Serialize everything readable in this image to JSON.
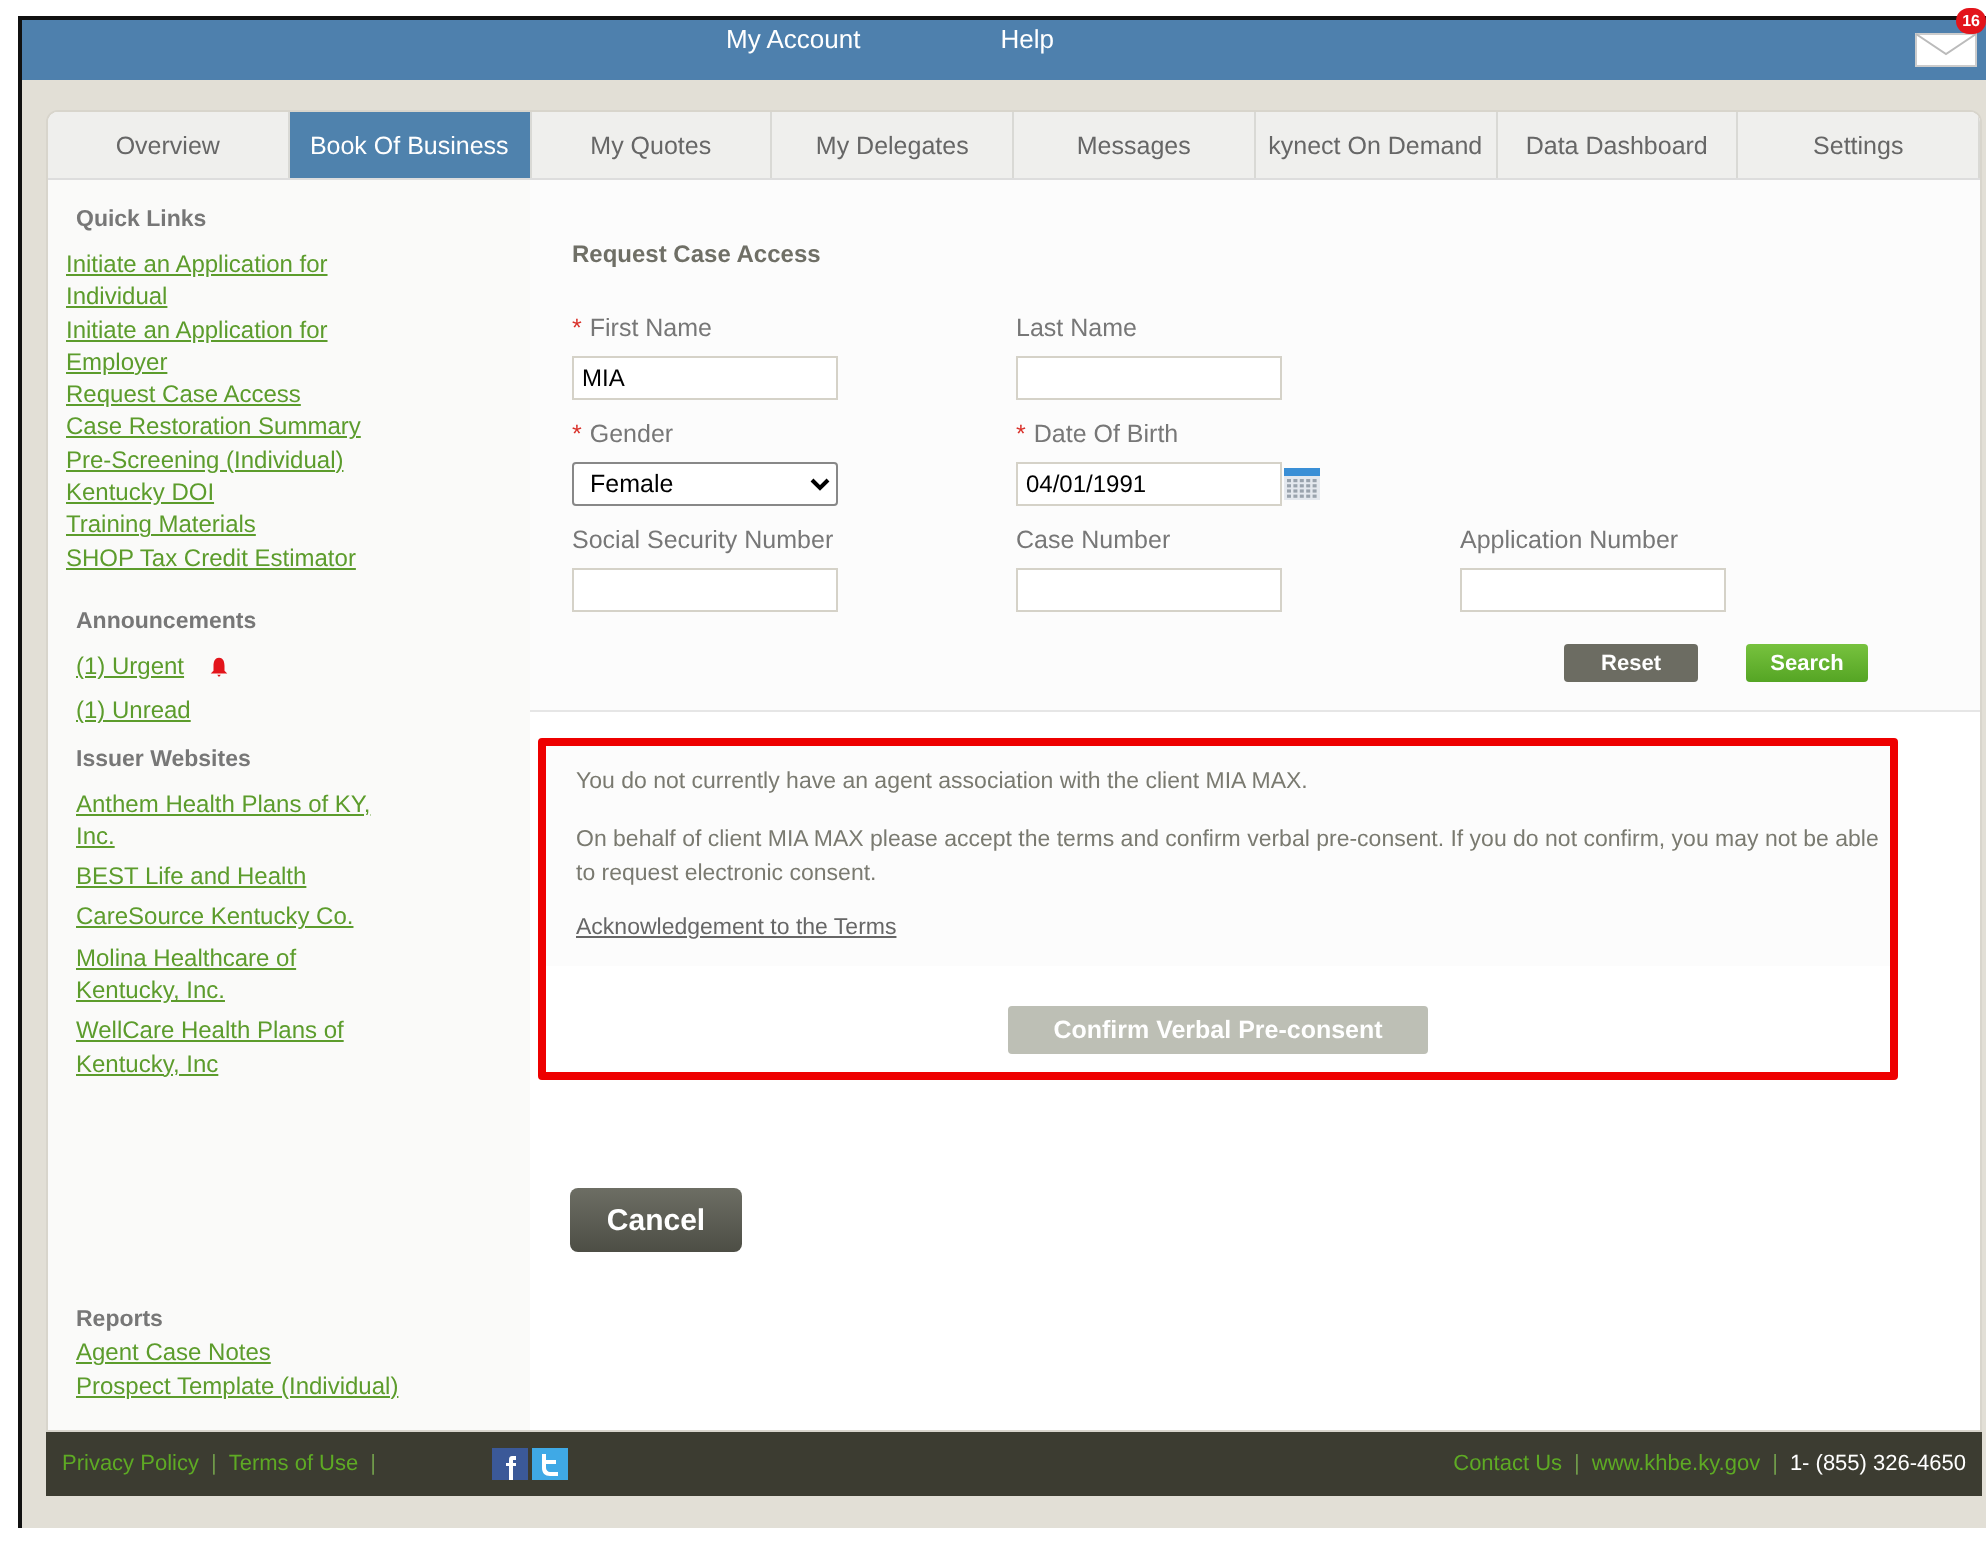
{
  "header": {
    "nav": [
      "My Account",
      "Help"
    ],
    "mail_count": "16"
  },
  "tabs": [
    {
      "label": "Overview",
      "selected": false
    },
    {
      "label": "Book Of Business",
      "selected": true
    },
    {
      "label": "My Quotes",
      "selected": false
    },
    {
      "label": "My Delegates",
      "selected": false
    },
    {
      "label": "Messages",
      "selected": false
    },
    {
      "label": "kynect On Demand",
      "selected": false
    },
    {
      "label": "Data Dashboard",
      "selected": false
    },
    {
      "label": "Settings",
      "selected": false
    }
  ],
  "sidebar": {
    "quick_links": {
      "title": "Quick Links",
      "links": [
        "Initiate an Application for Individual",
        "Initiate an Application for Employer",
        "Request Case Access",
        "Case Restoration Summary",
        "Pre-Screening (Individual)",
        "Kentucky DOI",
        "Training Materials",
        "SHOP Tax Credit Estimator"
      ]
    },
    "announcements": {
      "title": "Announcements",
      "links": [
        {
          "text": "(1) Urgent",
          "alert": true
        },
        {
          "text": "(1) Unread",
          "alert": false
        }
      ]
    },
    "issuer_websites": {
      "title": "Issuer Websites",
      "links": [
        "Anthem Health Plans of KY, Inc.",
        "BEST Life and Health",
        "CareSource Kentucky Co.",
        "Molina Healthcare of Kentucky, Inc.",
        "WellCare Health Plans of Kentucky, Inc"
      ]
    },
    "reports": {
      "title": "Reports",
      "links": [
        "Agent Case Notes",
        "Prospect Template (Individual)"
      ]
    }
  },
  "form": {
    "title": "Request Case Access",
    "required_mark": "*",
    "fields": [
      {
        "label": "First Name",
        "required": true,
        "kind": "text",
        "value": "MIA"
      },
      {
        "label": "Last Name",
        "required": false,
        "kind": "text"
      },
      {
        "kind": "empty"
      },
      {
        "label": "Gender",
        "required": true,
        "kind": "select",
        "value": "Female"
      },
      {
        "label": "Date Of Birth",
        "required": true,
        "kind": "date",
        "value": "04/01/1991"
      },
      {
        "kind": "empty"
      },
      {
        "label": "Social Security Number",
        "required": false,
        "kind": "text"
      },
      {
        "label": "Case Number",
        "required": false,
        "kind": "text"
      },
      {
        "label": "Application Number",
        "required": false,
        "kind": "text"
      }
    ],
    "buttons": [
      {
        "label": "Reset",
        "kind": "secondary"
      },
      {
        "label": "Search",
        "kind": "primary"
      }
    ]
  },
  "consent": {
    "messages": [
      "You do not currently have an agent association with the client MIA MAX.",
      "On behalf of client MIA MAX please accept the terms and confirm verbal pre-consent. If you do not confirm, you may not be able to request electronic consent."
    ],
    "link": "Acknowledgement to the Terms",
    "button": {
      "label": "Confirm Verbal Pre-consent",
      "disabled": true
    }
  },
  "cancel_button": "Cancel",
  "footer": {
    "left": [
      {
        "kind": "link",
        "text": "Privacy Policy"
      },
      {
        "kind": "sep",
        "text": "|"
      },
      {
        "kind": "link",
        "text": "Terms of Use"
      },
      {
        "kind": "sep",
        "text": "|"
      }
    ],
    "right": [
      {
        "kind": "link",
        "text": "Contact Us"
      },
      {
        "kind": "sep",
        "text": "|"
      },
      {
        "kind": "link",
        "text": "www.khbe.ky.gov"
      },
      {
        "kind": "sep",
        "text": "|"
      },
      {
        "kind": "plain",
        "text": "1- (855) 326-4650"
      }
    ]
  }
}
